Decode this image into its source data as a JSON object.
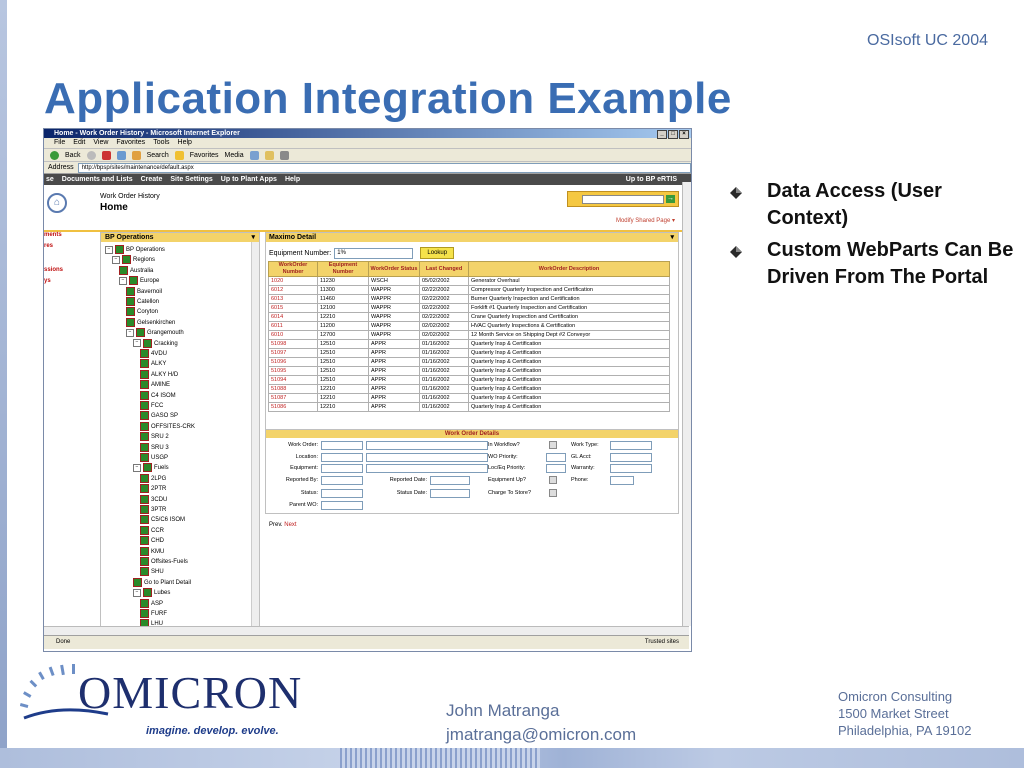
{
  "slide": {
    "top_right": "OSIsoft UC 2004",
    "title": "Application Integration Example",
    "bullets": [
      "Data Access (User Context)",
      "Custom WebParts Can Be Driven From The Portal"
    ],
    "presenter_name": "John Matranga",
    "presenter_email": "jmatranga@omicron.com",
    "company_name": "Omicron Consulting",
    "company_street": "1500 Market Street",
    "company_city": "Philadelphia, PA 19102",
    "logo_text": "OMICRON",
    "logo_tagline": "imagine. develop. evolve."
  },
  "browser": {
    "window_title": "Home - Work Order History - Microsoft Internet Explorer",
    "menu": [
      "File",
      "Edit",
      "View",
      "Favorites",
      "Tools",
      "Help"
    ],
    "toolbar": {
      "back": "Back",
      "search": "Search",
      "favorites": "Favorites",
      "media": "Media"
    },
    "address_label": "Address",
    "address_value": "http://bpsp/sites/maintenance/default.aspx",
    "status_left": "Done",
    "status_right": "Trusted sites"
  },
  "portal": {
    "nav": [
      "se",
      "Documents and Lists",
      "Create",
      "Site Settings",
      "Up to Plant Apps",
      "Help"
    ],
    "nav_right": "Up to BP eRTIS",
    "breadcrumb": "Work Order History",
    "page_title": "Home",
    "modify_shared": "Modify Shared Page ▾",
    "left_links": [
      "ments",
      "res",
      "ssions",
      "ys"
    ]
  },
  "tree": {
    "header": "BP Operations",
    "items": [
      "BP Operations",
      "Regions",
      "Australia",
      "Europe",
      "Bavernoil",
      "Catellon",
      "Coryton",
      "Gelsenkirchen",
      "Grangemouth",
      "Cracking",
      "4VDU",
      "ALKY",
      "ALKY H/D",
      "AMINE",
      "C4 ISOM",
      "FCC",
      "GASO SP",
      "OFFSITES-CRK",
      "SRU 2",
      "SRU 3",
      "USGP",
      "Fuels",
      "2LPG",
      "2PTR",
      "3CDU",
      "3PTR",
      "C5/C6 ISOM",
      "CCR",
      "CHD",
      "KMU",
      "Offsites-Fuels",
      "SHU",
      "Go to Plant Detail",
      "Lubes",
      "ASP",
      "FURF",
      "LHU"
    ]
  },
  "maximo": {
    "header": "Maximo Detail",
    "equip_label": "Equipment Number:",
    "equip_value": "1%",
    "lookup_label": "Lookup",
    "columns": [
      "WorkOrder Number",
      "Equipment Number",
      "WorkOrder Status",
      "Last Changed",
      "WorkOrder Description"
    ],
    "rows": [
      [
        "1020",
        "11230",
        "WSCH",
        "05/02/2002",
        "Generator Overhaul"
      ],
      [
        "6012",
        "11300",
        "WAPPR",
        "02/22/2002",
        "Compressor Quarterly Inspection and Certification"
      ],
      [
        "6013",
        "11460",
        "WAPPR",
        "02/22/2002",
        "Burner Quarterly Inspection and Certification"
      ],
      [
        "6015",
        "12100",
        "WAPPR",
        "02/22/2002",
        "Forklift #1 Quarterly Inspection and Certification"
      ],
      [
        "6014",
        "12210",
        "WAPPR",
        "02/22/2002",
        "Crane Quarterly Inspection and Certification"
      ],
      [
        "6011",
        "11200",
        "WAPPR",
        "02/02/2002",
        "HVAC Quarterly Inspections & Certification"
      ],
      [
        "6010",
        "12700",
        "WAPPR",
        "02/02/2002",
        "12 Month Service on Shipping Dept #2 Conveyor"
      ],
      [
        "51098",
        "12510",
        "APPR",
        "01/16/2002",
        "Quarterly Insp & Certification"
      ],
      [
        "51097",
        "12510",
        "APPR",
        "01/16/2002",
        "Quarterly Insp & Certification"
      ],
      [
        "51096",
        "12510",
        "APPR",
        "01/16/2002",
        "Quarterly Insp & Certification"
      ],
      [
        "51095",
        "12510",
        "APPR",
        "01/16/2002",
        "Quarterly Insp & Certification"
      ],
      [
        "51094",
        "12510",
        "APPR",
        "01/16/2002",
        "Quarterly Insp & Certification"
      ],
      [
        "51088",
        "12210",
        "APPR",
        "01/16/2002",
        "Quarterly Insp & Certification"
      ],
      [
        "51087",
        "12210",
        "APPR",
        "01/16/2002",
        "Quarterly Insp & Certification"
      ],
      [
        "51086",
        "12210",
        "APPR",
        "01/16/2002",
        "Quarterly Insp & Certification"
      ]
    ],
    "prev": "Prev.",
    "next": "Next"
  },
  "details": {
    "header": "Work Order Details",
    "labels": {
      "work_order": "Work Order:",
      "location": "Location:",
      "equipment": "Equipment:",
      "reported_by": "Reported By:",
      "status": "Status:",
      "parent_wo": "Parent WO:",
      "reported_date": "Reported Date:",
      "status_date": "Status Date:",
      "in_workflow": "In Workflow?",
      "wo_priority": "WO Priority:",
      "loc_priority": "Loc/Eq Priority:",
      "equip_up": "Equipment Up?",
      "charge_to_store": "Charge To Store?",
      "work_type": "Work Type:",
      "gl_acct": "GL Acct:",
      "warranty": "Warranty:",
      "phone": "Phone:"
    }
  }
}
